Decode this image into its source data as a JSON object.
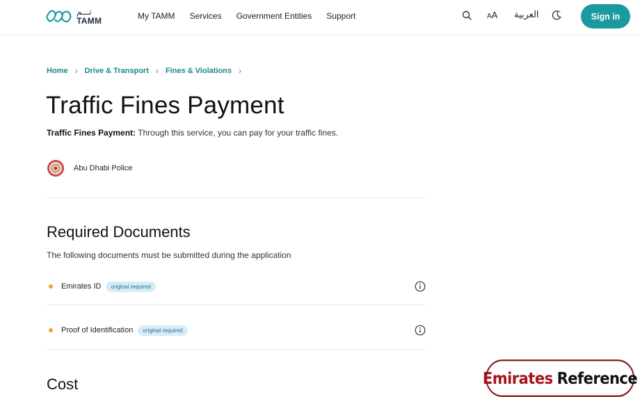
{
  "header": {
    "logo_ar": "تـــم",
    "logo_en": "TAMM",
    "nav": [
      "My TAMM",
      "Services",
      "Government Entities",
      "Support"
    ],
    "font_size_label_small": "A",
    "font_size_label_large": "A",
    "language_label": "العربية",
    "sign_in_label": "Sign in"
  },
  "breadcrumb": [
    "Home",
    "Drive & Transport",
    "Fines & Violations"
  ],
  "page": {
    "title": "Traffic Fines Payment",
    "description_bold": "Traffic Fines Payment:",
    "description": " Through this service, you can pay for your traffic fines.",
    "entity": "Abu Dhabi Police"
  },
  "required_documents": {
    "heading": "Required Documents",
    "intro": "The following documents must be submitted during the application",
    "items": [
      {
        "name": "Emirates ID",
        "badge": "original required"
      },
      {
        "name": "Proof of Identification",
        "badge": "original required"
      }
    ]
  },
  "cost": {
    "heading": "Cost"
  },
  "watermark": {
    "part1": "Emirates",
    "part2": "Reference"
  },
  "colors": {
    "accent": "#1a9aa0",
    "link": "#18888e",
    "dot": "#e8a23a",
    "badge_bg": "#d6ecf8"
  }
}
